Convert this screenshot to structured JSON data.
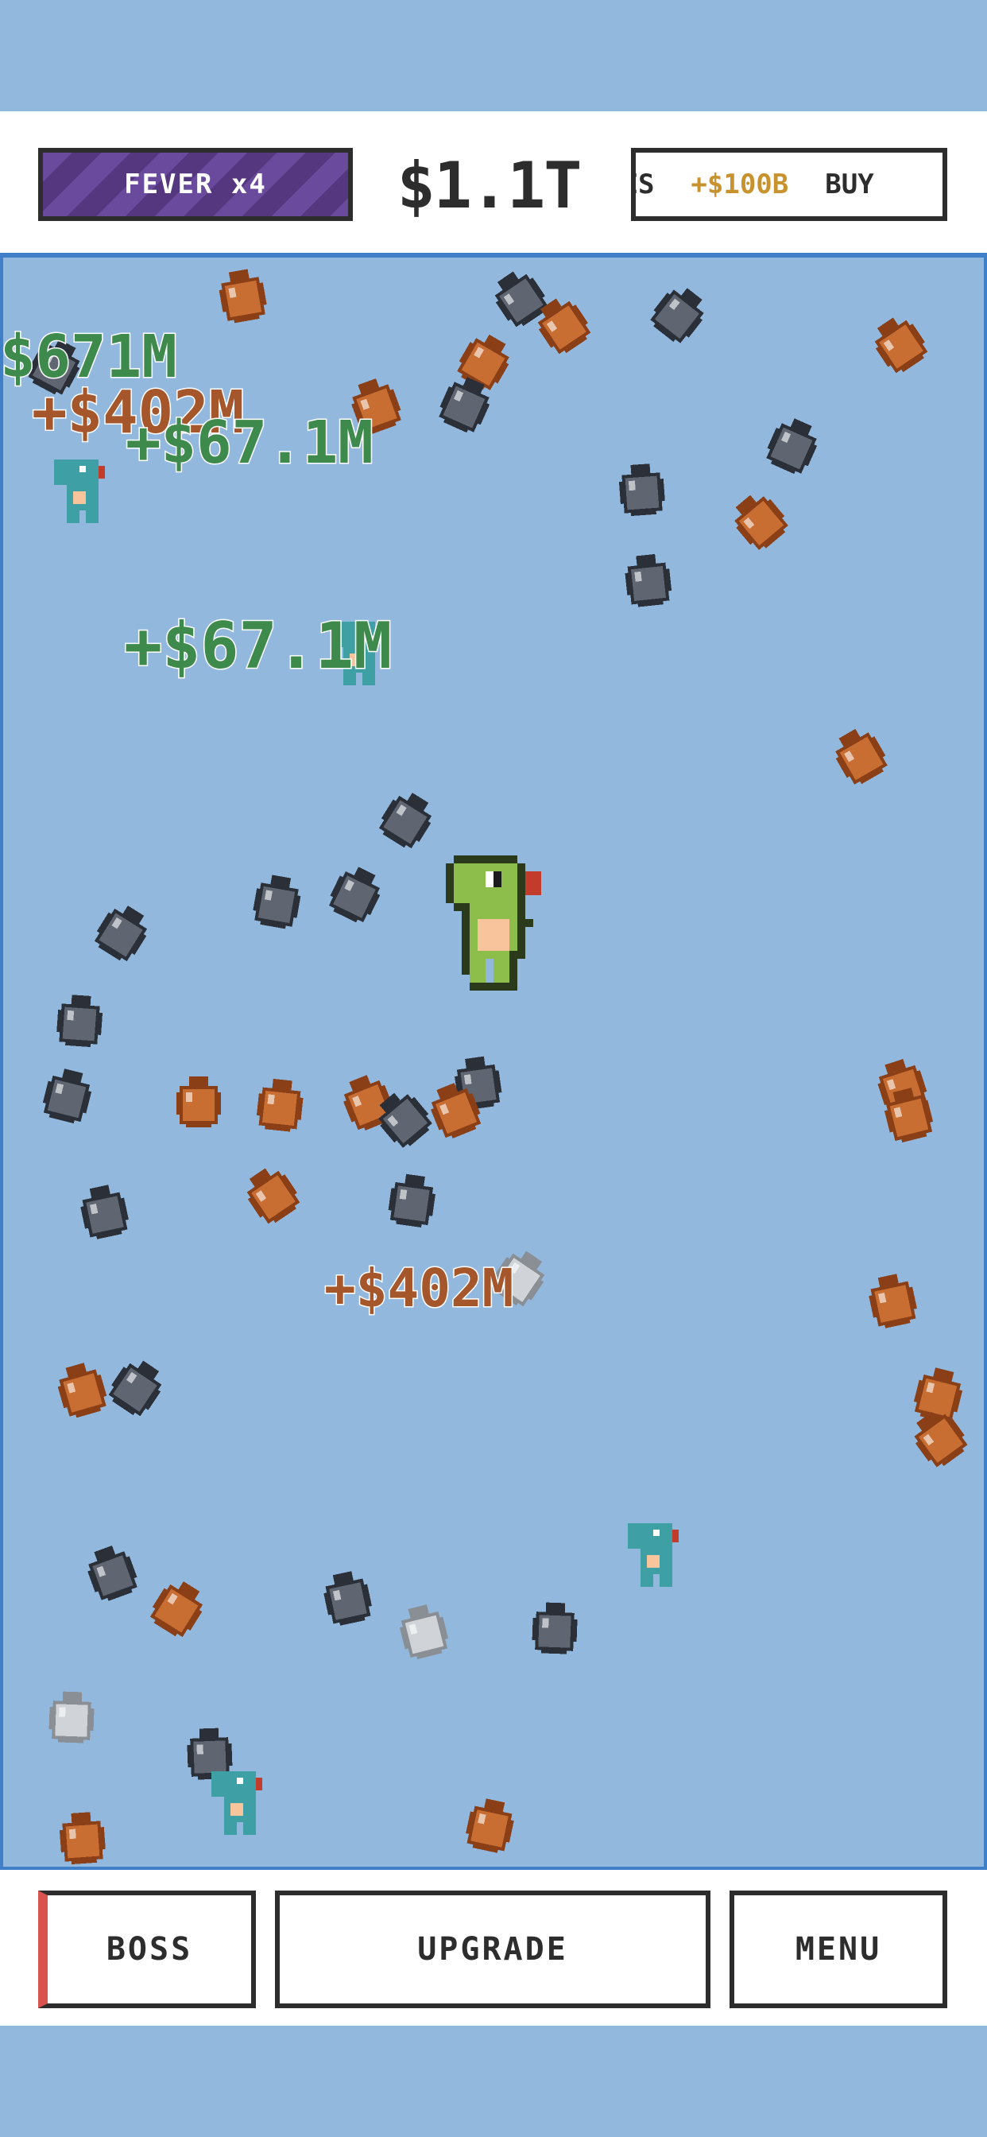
{
  "hud": {
    "fever_label": "FEVER x4",
    "money": "$1.1T",
    "ticker": {
      "left_fragment": "DES",
      "reward": "+$100B",
      "right_fragment": "BUY"
    }
  },
  "floating_texts": [
    {
      "text": "$671M",
      "color": "#3e8a4c"
    },
    {
      "text": "+$402M",
      "color": "#a5562a"
    },
    {
      "text": "+$67.1M",
      "color": "#3e8a4c"
    },
    {
      "text": "+$67.1M",
      "color": "#3e8a4c"
    },
    {
      "text": "+$402M",
      "color": "#a5562a"
    }
  ],
  "colors": {
    "background": "#93b8de",
    "fever": "#6a4a9c",
    "pot_orange": "#c96e33",
    "pot_gray": "#5f6672",
    "pot_silver": "#d0d4d8",
    "dino_green": "#8dbd4a",
    "dino_teal": "#3ea0a4"
  },
  "buttons": {
    "boss": "BOSS",
    "upgrade": "UPGRADE",
    "menu": "MENU"
  }
}
